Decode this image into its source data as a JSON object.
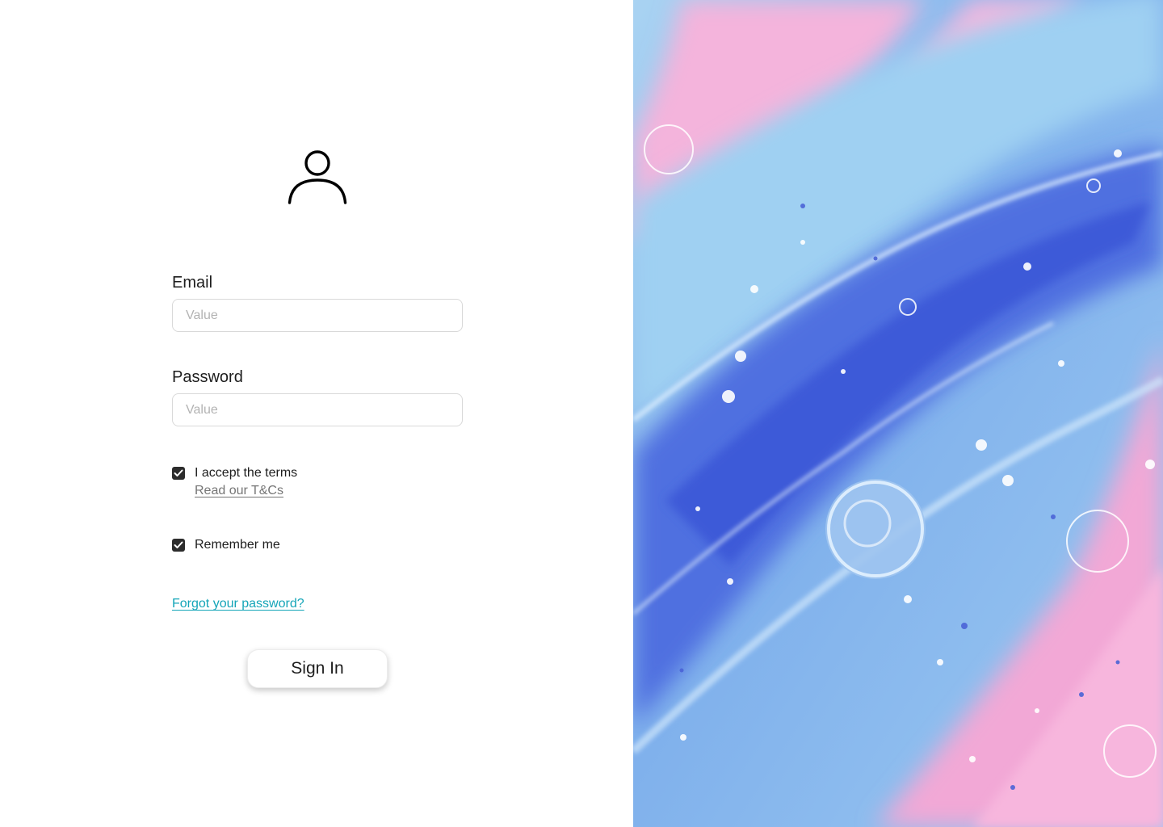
{
  "form": {
    "email": {
      "label": "Email",
      "placeholder": "Value",
      "value": ""
    },
    "password": {
      "label": "Password",
      "placeholder": "Value",
      "value": ""
    },
    "terms": {
      "label": "I accept the terms",
      "link_label": "Read our T&Cs",
      "checked": true
    },
    "remember": {
      "label": "Remember me",
      "checked": true
    },
    "forgot_password_label": "Forgot your password?",
    "sign_in_label": "Sign In"
  },
  "icons": {
    "avatar": "user-icon",
    "checkbox_mark": "check-icon"
  },
  "colors": {
    "text": "#1e1e1e",
    "placeholder": "#b3b3b3",
    "input_border": "#d9d9d9",
    "checkbox_fill": "#2c2c2c",
    "terms_link": "#757575",
    "forgot_link": "#14a5b8",
    "art_blue": "#5a7ee8",
    "art_light_blue": "#8cc0ec",
    "art_pink": "#f0a8d8"
  }
}
